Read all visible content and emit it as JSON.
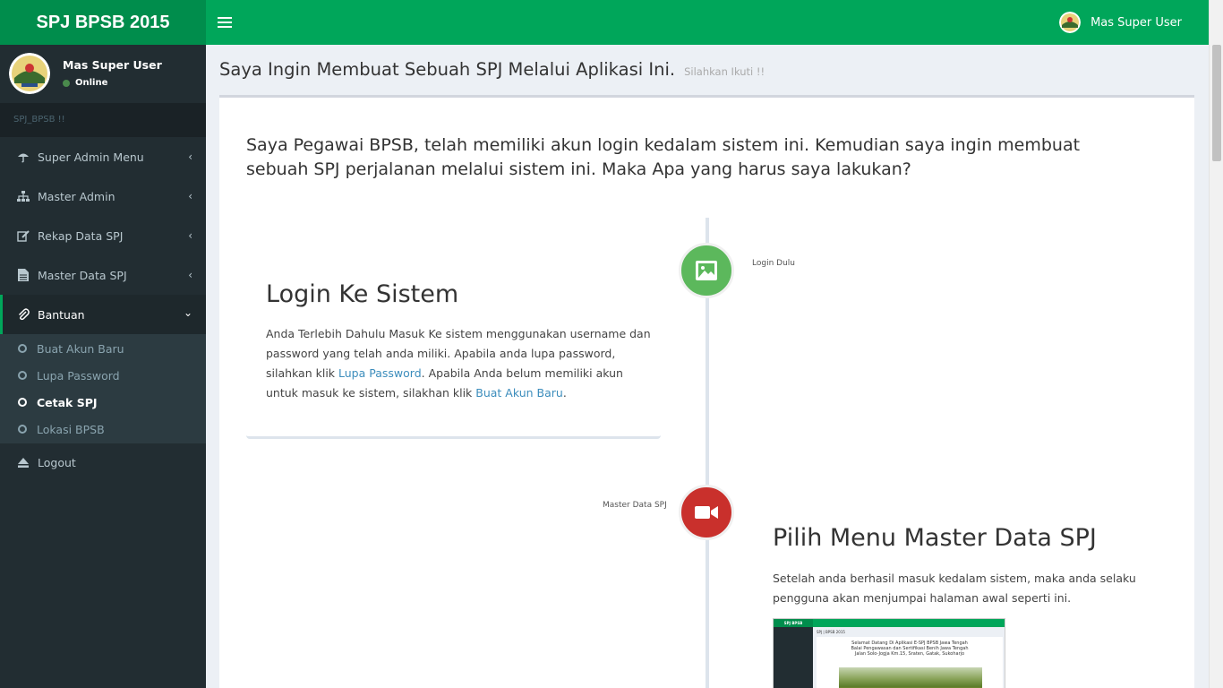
{
  "app": {
    "logo_text": "SPJ BPSB 2015",
    "brand_color": "#00a65a"
  },
  "navbar": {
    "user_name": "Mas Super User"
  },
  "sidebar": {
    "user_name": "Mas Super User",
    "user_status": "Online",
    "header": "SPJ_BPSB !!",
    "menu": [
      {
        "label": "Super Admin Menu",
        "icon": "umbrella-icon"
      },
      {
        "label": "Master Admin",
        "icon": "sitemap-icon"
      },
      {
        "label": "Rekap Data SPJ",
        "icon": "edit-icon"
      },
      {
        "label": "Master Data SPJ",
        "icon": "file-icon"
      },
      {
        "label": "Bantuan",
        "icon": "paperclip-icon"
      }
    ],
    "submenu": [
      {
        "label": "Buat Akun Baru"
      },
      {
        "label": "Lupa Password"
      },
      {
        "label": "Cetak SPJ"
      },
      {
        "label": "Lokasi BPSB"
      }
    ],
    "logout": "Logout"
  },
  "content": {
    "title": "Saya Ingin Membuat Sebuah SPJ Melalui Aplikasi Ini.",
    "subtitle": "Silahkan Ikuti !!",
    "intro": "Saya Pegawai BPSB, telah memiliki akun login kedalam sistem ini. Kemudian saya ingin membuat sebuah SPJ perjalanan melalui sistem ini. Maka Apa yang harus saya lakukan?",
    "step1": {
      "tag": "Login Dulu",
      "heading": "Login Ke Sistem",
      "text_a": "Anda Terlebih Dahulu Masuk Ke sistem menggunakan username dan password yang telah anda miliki. Apabila anda lupa password, silahkan klik ",
      "link_a": "Lupa Password",
      "text_b": ". Apabila Anda belum memiliki akun untuk masuk ke sistem, silakhan klik ",
      "link_b": "Buat Akun Baru",
      "text_c": "."
    },
    "step2": {
      "tag": "Master Data SPJ",
      "heading": "Pilih Menu Master Data SPJ",
      "text": "Setelah anda berhasil masuk kedalam sistem, maka anda selaku pengguna akan menjumpai halaman awal seperti ini.",
      "shot": {
        "logo": "SPJ BPSB",
        "header": "SPJ | BPSB 2015",
        "line1": "Selamat Datang Di Aplikasi E-SPJ BPSB Jawa Tengah",
        "line2": "Balai Pengawasan dan Sertifikasi Benih Jawa Tengah",
        "line3": "Jalan Solo-Jogja Km.15, Sraten, Gatak, Sukoharjo"
      }
    }
  }
}
